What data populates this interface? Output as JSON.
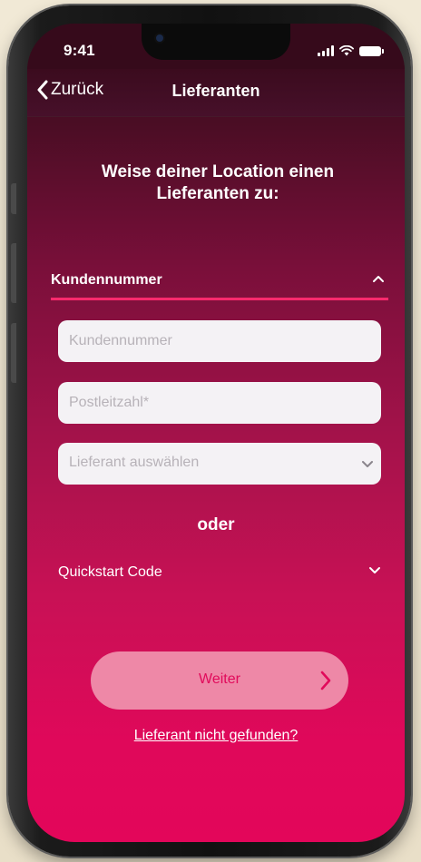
{
  "status_bar": {
    "time": "9:41",
    "icons": [
      "signal-icon",
      "wifi-icon",
      "battery-icon"
    ]
  },
  "nav": {
    "back_label": "Zurück",
    "title": "Lieferanten"
  },
  "heading": "Weise deiner Location einen Lieferanten zu:",
  "section": {
    "label": "Kundennummer"
  },
  "form": {
    "customer_number_placeholder": "Kundennummer",
    "postal_code_placeholder": "Postleitzahl*",
    "supplier_select_value": "Lieferant auswählen"
  },
  "divider_text": "oder",
  "quickstart": {
    "label": "Quickstart Code"
  },
  "next_button": {
    "label": "Weiter"
  },
  "not_found_link": "Lieferant nicht gefunden?",
  "colors": {
    "accent": "#ff2a6d",
    "gradient_top": "#3b0b1e",
    "gradient_bottom": "#e3065a",
    "button_bg": "#ee88a7",
    "button_text": "#e10a5b",
    "field_bg": "#f4f2f5"
  }
}
